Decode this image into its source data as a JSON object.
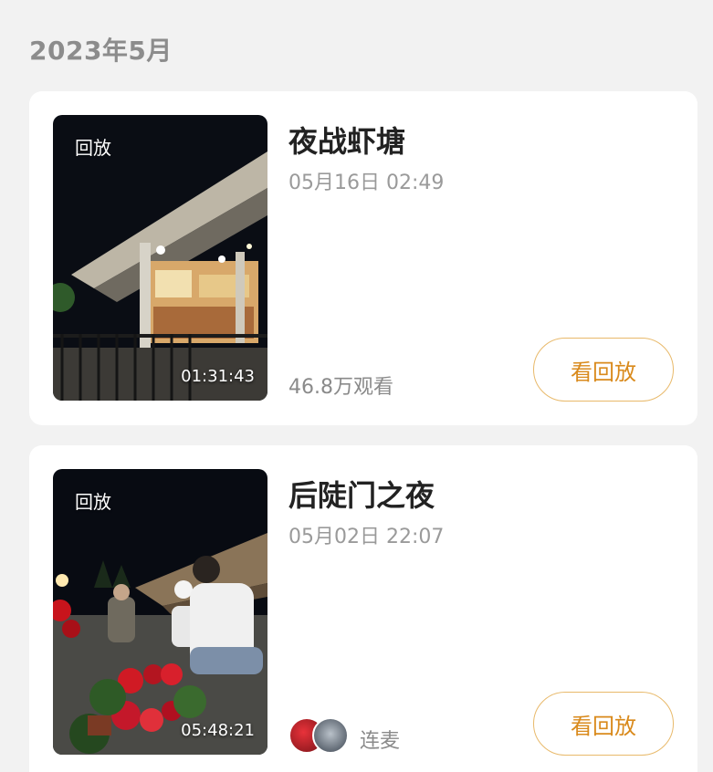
{
  "month_header": "2023年5月",
  "streams": [
    {
      "badge": "回放",
      "duration": "01:31:43",
      "title": "夜战虾塘",
      "datetime": "05月16日 02:49",
      "views": "46.8万观看",
      "button_label": "看回放"
    },
    {
      "badge": "回放",
      "duration": "05:48:21",
      "title": "后陡门之夜",
      "datetime": "05月02日 22:07",
      "tag": "连麦",
      "button_label": "看回放"
    }
  ],
  "colors": {
    "accent": "#d98a1c",
    "button_border": "#e8b96a",
    "page_bg": "#f2f2f2"
  }
}
